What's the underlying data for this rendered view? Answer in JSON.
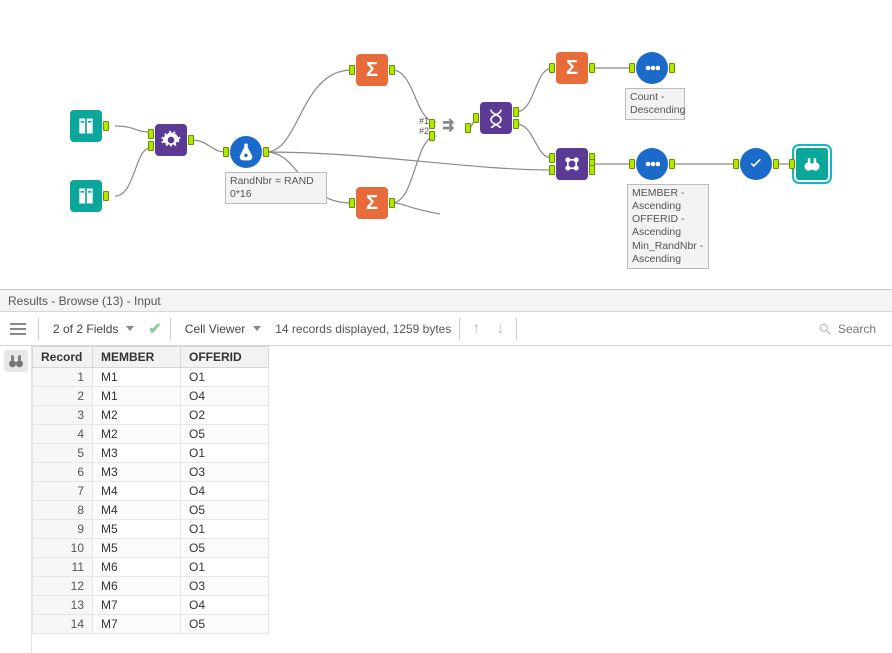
{
  "canvas": {
    "formula_annotation": "RandNbr = RAND 0*16",
    "union_label1": "#1",
    "union_label2": "#2",
    "sort1_annotation": "Count - Descending",
    "sort2_annotation": "MEMBER - Ascending\nOFFERID - Ascending\nMin_RandNbr - Ascending"
  },
  "results": {
    "title": "Results - Browse (13) - Input",
    "fields_label": "2 of 2 Fields",
    "cell_viewer_label": "Cell Viewer",
    "records_label": "14 records displayed, 1259 bytes",
    "search_placeholder": "Search"
  },
  "grid": {
    "col_record": "Record",
    "col_member": "MEMBER",
    "col_offerid": "OFFERID",
    "rows": [
      {
        "n": "1",
        "member": "M1",
        "offerid": "O1"
      },
      {
        "n": "2",
        "member": "M1",
        "offerid": "O4"
      },
      {
        "n": "3",
        "member": "M2",
        "offerid": "O2"
      },
      {
        "n": "4",
        "member": "M2",
        "offerid": "O5"
      },
      {
        "n": "5",
        "member": "M3",
        "offerid": "O1"
      },
      {
        "n": "6",
        "member": "M3",
        "offerid": "O3"
      },
      {
        "n": "7",
        "member": "M4",
        "offerid": "O4"
      },
      {
        "n": "8",
        "member": "M4",
        "offerid": "O5"
      },
      {
        "n": "9",
        "member": "M5",
        "offerid": "O1"
      },
      {
        "n": "10",
        "member": "M5",
        "offerid": "O5"
      },
      {
        "n": "11",
        "member": "M6",
        "offerid": "O1"
      },
      {
        "n": "12",
        "member": "M6",
        "offerid": "O3"
      },
      {
        "n": "13",
        "member": "M7",
        "offerid": "O4"
      },
      {
        "n": "14",
        "member": "M7",
        "offerid": "O5"
      }
    ]
  }
}
